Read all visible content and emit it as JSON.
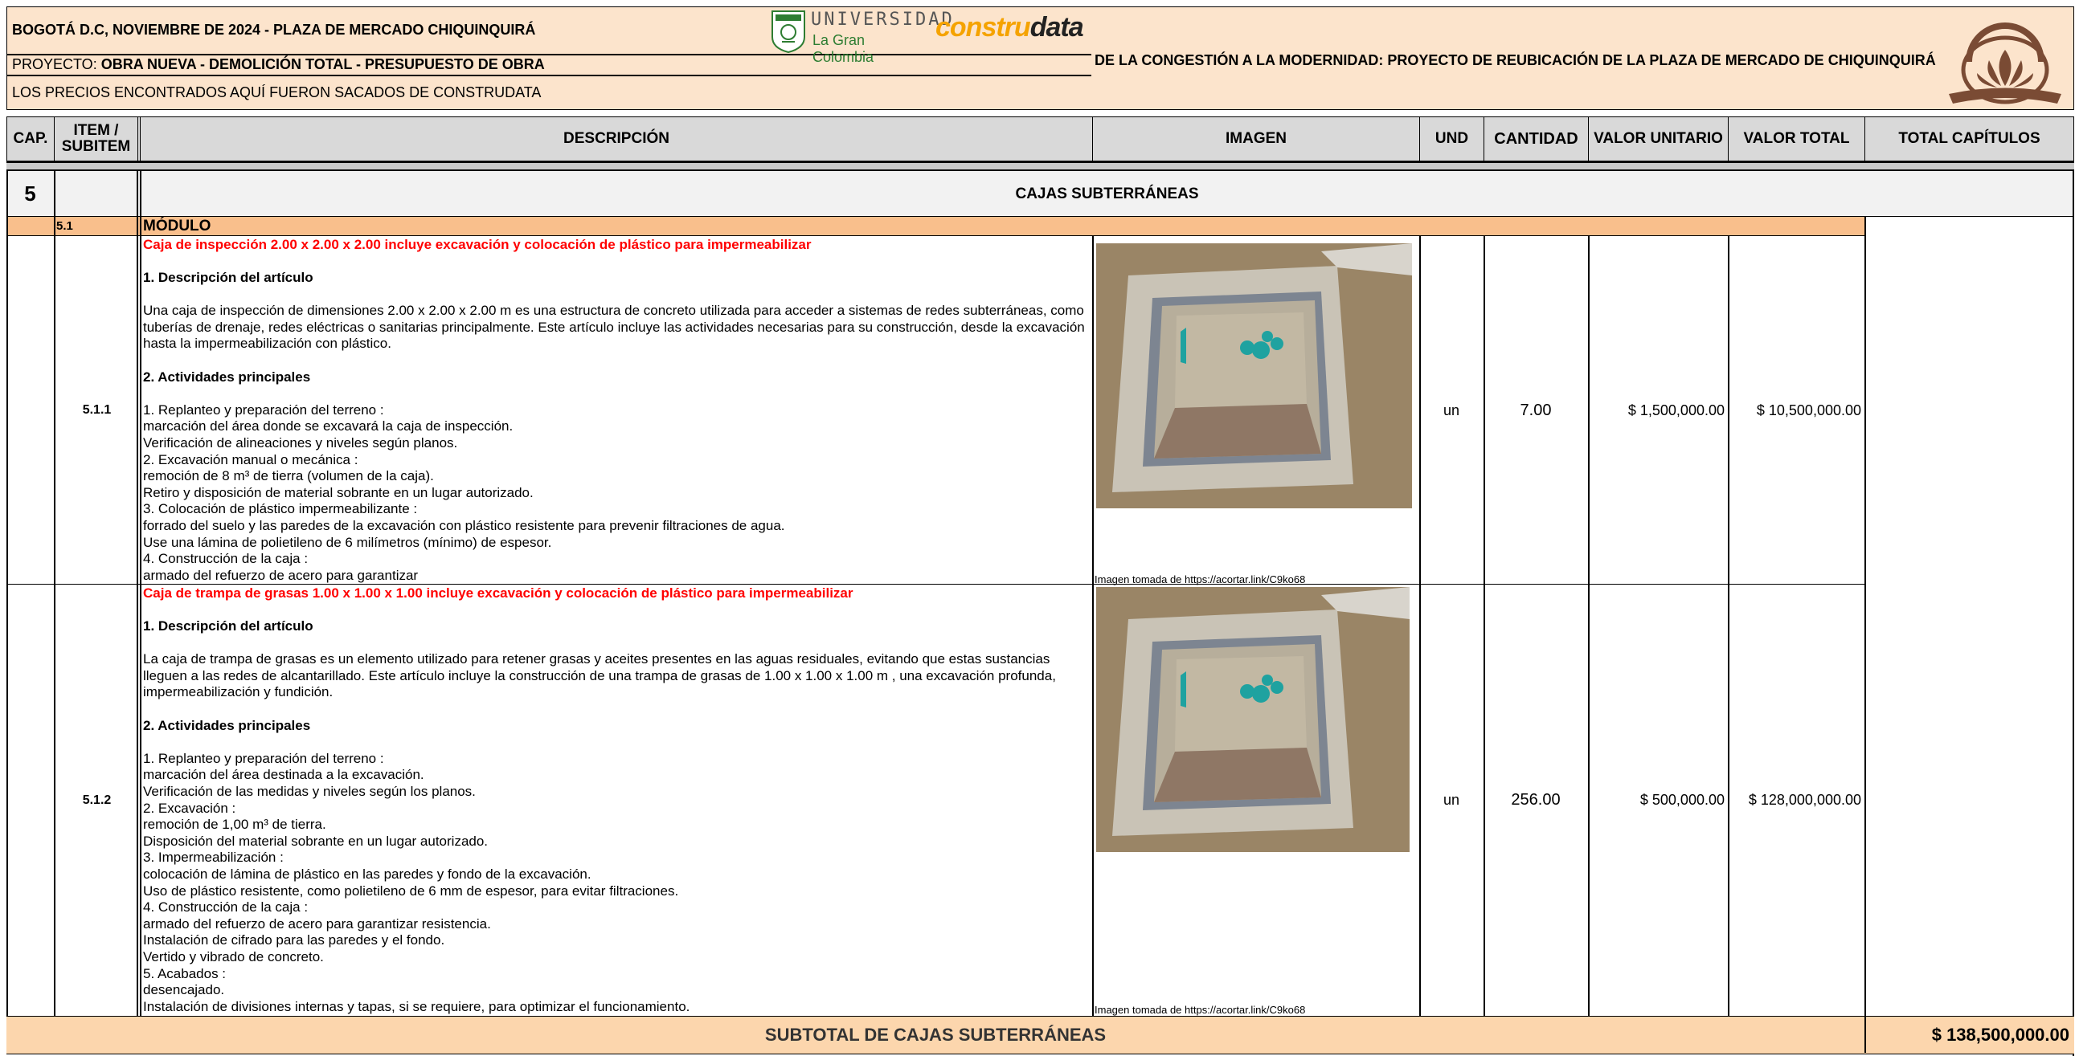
{
  "header": {
    "line1": "BOGOTÁ D.C, NOVIEMBRE DE 2024 - PLAZA DE MERCADO CHIQUINQUIRÁ",
    "line2_prefix": "PROYECTO: ",
    "line2_bold": "OBRA NUEVA - DEMOLICIÓN TOTAL - PRESUPUESTO DE OBRA",
    "line3": "LOS PRECIOS ENCONTRADOS AQUÍ FUERON SACADOS DE CONSTRUDATA",
    "project_title": "DE LA CONGESTIÓN A LA MODERNIDAD: PROYECTO DE REUBICACIÓN DE LA PLAZA DE MERCADO DE CHIQUINQUIRÁ",
    "logo_univ_line1": "UNIVERSIDAD",
    "logo_univ_line2": "La Gran Colombia",
    "logo_construdata_a": "con",
    "logo_construdata_b": "stru",
    "logo_construdata_c": "data"
  },
  "columns": {
    "cap": "CAP.",
    "item": "ITEM /\nSUBITEM",
    "desc": "DESCRIPCIÓN",
    "image": "IMAGEN",
    "und": "UND",
    "cantidad": "CANTIDAD",
    "valor_unitario": "VALOR UNITARIO",
    "valor_total": "VALOR TOTAL",
    "total_capitulos": "TOTAL CAPÍTULOS"
  },
  "chapter": {
    "number": "5",
    "title": "CAJAS SUBTERRÁNEAS"
  },
  "module": {
    "code": "5.1",
    "title": "MÓDULO"
  },
  "items": [
    {
      "code": "5.1.1",
      "title": "Caja de inspección 2.00 x 2.00 x 2.00 incluye excavación y colocación de plástico para impermeabilizar",
      "heading1": "1. Descripción del artículo",
      "desc": "Una caja de inspección de dimensiones 2.00 x 2.00 x 2.00 m es una estructura de concreto utilizada para acceder a sistemas de redes subterráneas, como tuberías de drenaje, redes eléctricas o sanitarias principalmente. Este artículo incluye las actividades necesarias para su construcción, desde la excavación hasta la impermeabilización con plástico.",
      "heading2": "2. Actividades principales",
      "activities": "1. Replanteo y preparación del terreno :\nmarcación del área donde se excavará la caja de inspección.\nVerificación de alineaciones y niveles según planos.\n2. Excavación manual o mecánica :\nremoción de 8 m³ de tierra (volumen de la caja).\nRetiro y disposición de material sobrante en un lugar autorizado.\n3. Colocación de plástico impermeabilizante :\nforrado del suelo y las paredes de la excavación con plástico resistente para prevenir filtraciones de agua.\nUse una lámina de polietileno de 6 milímetros (mínimo) de espesor.\n4. Construcción de la caja :\narmado del refuerzo de acero para garantizar",
      "image_caption": "Imagen tomada de https://acortar.link/C9ko68",
      "und": "un",
      "cantidad": "7.00",
      "valor_unitario": "$ 1,500,000.00",
      "valor_total": "$ 10,500,000.00"
    },
    {
      "code": "5.1.2",
      "title": "Caja de trampa de grasas 1.00 x 1.00 x 1.00 incluye excavación y colocación de plástico para impermeabilizar",
      "heading1": "1. Descripción del artículo",
      "desc": "La caja de trampa de grasas es un elemento utilizado para retener grasas y aceites presentes en las aguas residuales, evitando que estas sustancias lleguen a las redes de alcantarillado. Este artículo incluye la construcción de una trampa de grasas de 1.00 x 1.00 x 1.00 m , una excavación profunda, impermeabilización y fundición.",
      "heading2": "2. Actividades principales",
      "activities": "1. Replanteo y preparación del terreno :\nmarcación del área destinada a la excavación.\nVerificación de las medidas y niveles según los planos.\n2. Excavación :\nremoción de 1,00 m³ de tierra.\nDisposición del material sobrante en un lugar autorizado.\n3. Impermeabilización :\ncolocación de lámina de plástico en las paredes y fondo de la excavación.\nUso de plástico resistente, como polietileno de 6 mm de espesor, para evitar filtraciones.\n4. Construcción de la caja :\narmado del refuerzo de acero para garantizar resistencia.\nInstalación de cifrado para las paredes y el fondo.\nVertido y vibrado de concreto.\n5. Acabados :\ndesencajado.\nInstalación de divisiones internas y tapas, si se requiere, para optimizar el funcionamiento.",
      "image_caption": "Imagen tomada de https://acortar.link/C9ko68",
      "und": "un",
      "cantidad": "256.00",
      "valor_unitario": "$ 500,000.00",
      "valor_total": "$ 128,000,000.00"
    }
  ],
  "subtotal": {
    "label": "SUBTOTAL DE CAJAS SUBTERRÁNEAS",
    "value": "$ 138,500,000.00"
  },
  "colors": {
    "header_bg": "#fce4cc",
    "module_bg": "#f9bf8c",
    "column_header_bg": "#d9d9d9",
    "title_red": "#ff0000",
    "logo_orange": "#f5a300",
    "univ_green": "#2e7d32",
    "logo_brown": "#7a4b34"
  }
}
